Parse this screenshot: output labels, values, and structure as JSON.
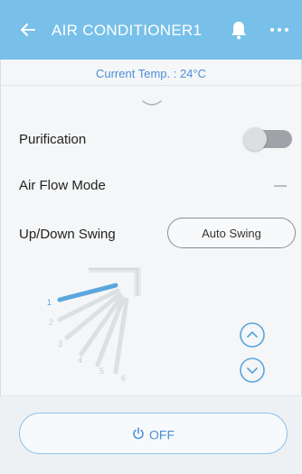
{
  "header": {
    "title": "AIR CONDITIONER1",
    "back_icon": "back-arrow-icon",
    "bell_icon": "bell-icon",
    "more_icon": "more-icon",
    "background_color": "#78c0ea"
  },
  "status": {
    "current_temp": "Current Temp. : 24°C"
  },
  "purification": {
    "label": "Purification",
    "enabled": false
  },
  "air_flow": {
    "label": "Air Flow Mode",
    "value": "–"
  },
  "swing": {
    "label": "Up/Down Swing",
    "mode_button": "Auto Swing",
    "positions": [
      "1",
      "2",
      "3",
      "4",
      "5",
      "6"
    ],
    "selected_position": "1"
  },
  "power": {
    "label": "OFF",
    "accent_color": "#4d8fd6"
  }
}
